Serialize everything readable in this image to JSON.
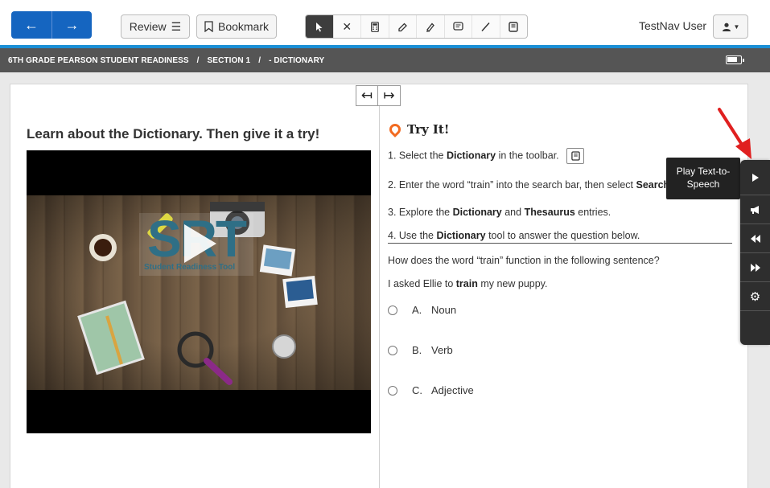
{
  "toolbar": {
    "back_icon": "arrow-left-icon",
    "forward_icon": "arrow-right-icon",
    "review_label": "Review",
    "review_icon": "list-icon",
    "bookmark_label": "Bookmark",
    "bookmark_icon": "bookmark-icon",
    "tools": [
      {
        "name": "pointer",
        "icon": "pointer-icon",
        "active": true
      },
      {
        "name": "answer-eliminator",
        "icon": "close-icon",
        "active": false
      },
      {
        "name": "calculator",
        "icon": "calculator-icon",
        "active": false
      },
      {
        "name": "eraser",
        "icon": "eraser-icon",
        "active": false
      },
      {
        "name": "highlighter",
        "icon": "highlighter-icon",
        "active": false
      },
      {
        "name": "notepad",
        "icon": "note-icon",
        "active": false
      },
      {
        "name": "line-reader",
        "icon": "line-icon",
        "active": false
      },
      {
        "name": "dictionary",
        "icon": "dictionary-icon",
        "active": false
      }
    ],
    "user_name": "TestNav User",
    "user_icon": "user-icon"
  },
  "breadcrumb": {
    "items": [
      "6TH GRADE PEARSON STUDENT READINESS",
      "SECTION 1",
      "- DICTIONARY"
    ],
    "separator": "/",
    "battery_icon": "battery-icon"
  },
  "left": {
    "heading": "Learn about the Dictionary. Then give it a try!",
    "video": {
      "logo_text": "SRT",
      "logo_subtitle": "Student Readiness Tool",
      "play_icon": "play-icon"
    }
  },
  "right": {
    "title": "Try It!",
    "title_icon": "pin-icon",
    "steps": [
      {
        "prefix": "1. Select the ",
        "bold": "Dictionary",
        "suffix": " in the toolbar."
      },
      {
        "prefix": "2. Enter the word “train” into the search bar, then select ",
        "bold": "Search",
        "suffix": ""
      },
      {
        "prefix": "3. Explore the ",
        "bold": "Dictionary",
        "mid": " and ",
        "bold2": "Thesaurus",
        "suffix": " entries."
      },
      {
        "prefix": "4. Use the ",
        "bold": "Dictionary",
        "suffix": " tool to answer the question below."
      }
    ],
    "question": "How does the word “train” function in the following sentence?",
    "sentence": {
      "prefix": "I asked Ellie to ",
      "bold": "train",
      "suffix": " my new puppy."
    },
    "choices": [
      {
        "letter": "A.",
        "text": "Noun"
      },
      {
        "letter": "B.",
        "text": "Verb"
      },
      {
        "letter": "C.",
        "text": "Adjective"
      }
    ]
  },
  "tooltip": "Play Text-to-Speech",
  "sidebar": [
    {
      "name": "play",
      "icon": "play-icon"
    },
    {
      "name": "megaphone",
      "icon": "megaphone-icon"
    },
    {
      "name": "rewind",
      "icon": "rewind-icon"
    },
    {
      "name": "fast-forward",
      "icon": "fast-forward-icon"
    },
    {
      "name": "settings",
      "icon": "gear-icon"
    }
  ],
  "colors": {
    "nav_blue": "#1565c0",
    "accent_blue": "#1a8fd6",
    "breadcrumb_bg": "#555555",
    "pin_orange": "#f26b21",
    "arrow_red": "#e02020"
  }
}
